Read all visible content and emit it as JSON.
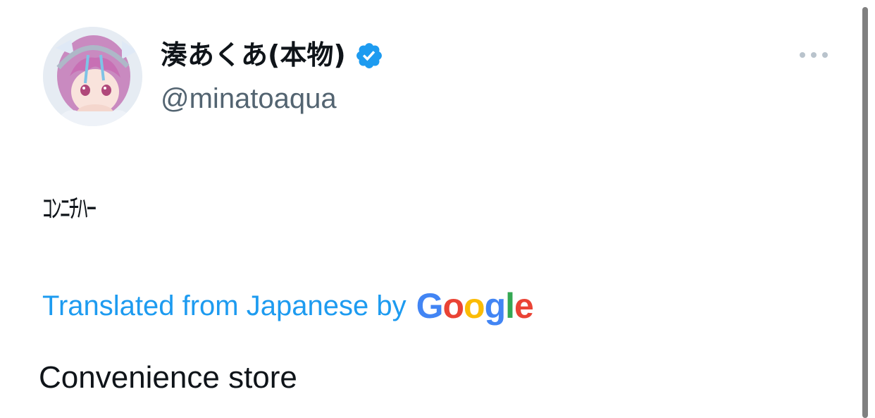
{
  "author": {
    "display_name": "湊あくあ(本物)",
    "handle": "@minatoaqua",
    "verified": true
  },
  "tweet": {
    "text": "ｺﾝﾆﾁﾊｰ",
    "translation_label": "Translated from Japanese by",
    "translation_provider": [
      "G",
      "o",
      "o",
      "g",
      "l",
      "e"
    ],
    "translated_text": "Convenience store"
  },
  "icons": {
    "more": "more-horizontal-icon",
    "verified": "verified-badge-icon"
  },
  "colors": {
    "accent": "#1d9bf0",
    "text_primary": "#0f1419",
    "text_secondary": "#536471",
    "google": [
      "#4285F4",
      "#EA4335",
      "#FBBC05",
      "#4285F4",
      "#34A853",
      "#EA4335"
    ]
  }
}
